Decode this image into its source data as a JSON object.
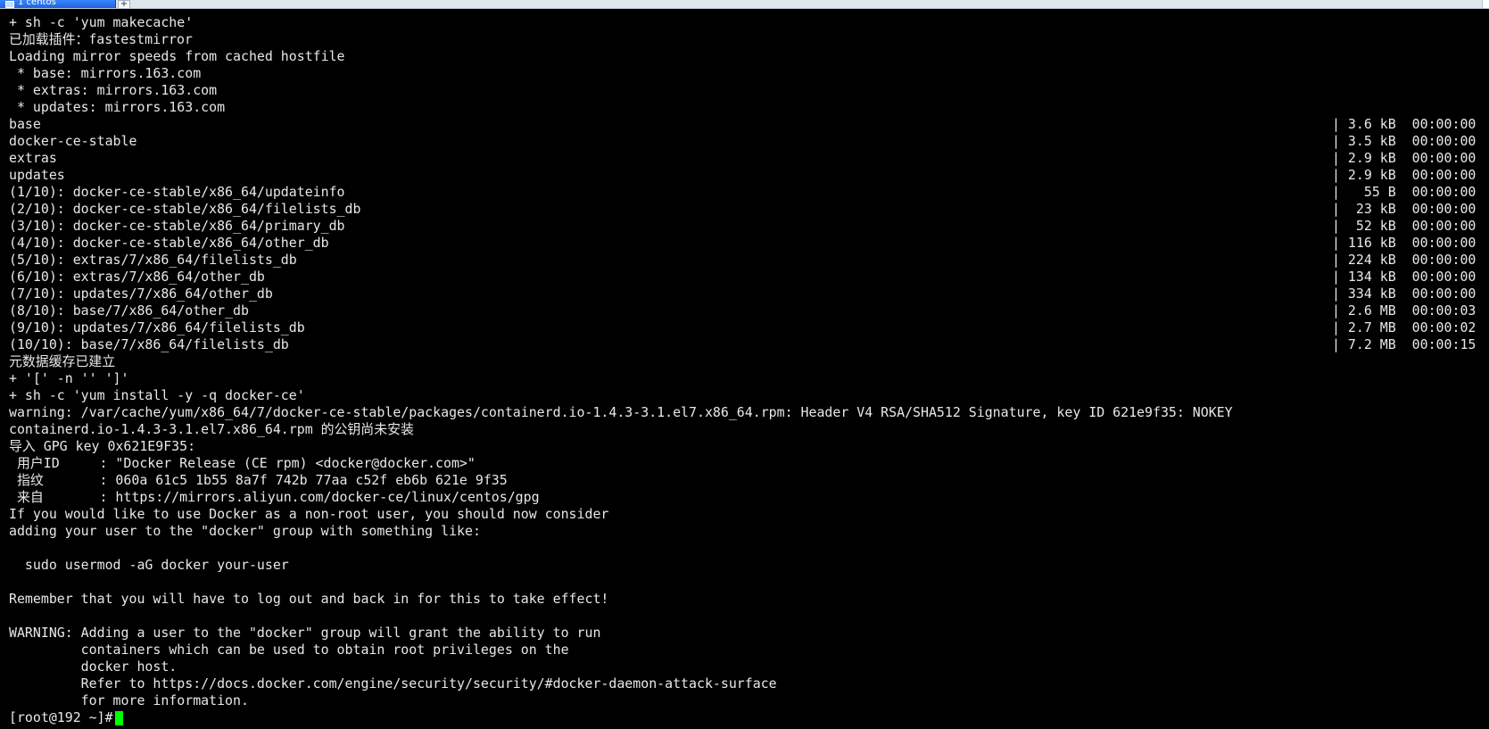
{
  "tab": {
    "title": "1 centos",
    "add_label": "+"
  },
  "terminal": {
    "lines": [
      {
        "text": "+ sh -c 'yum makecache'",
        "meta": ""
      },
      {
        "text": "已加载插件：fastestmirror",
        "meta": ""
      },
      {
        "text": "Loading mirror speeds from cached hostfile",
        "meta": ""
      },
      {
        "text": " * base: mirrors.163.com",
        "meta": ""
      },
      {
        "text": " * extras: mirrors.163.com",
        "meta": ""
      },
      {
        "text": " * updates: mirrors.163.com",
        "meta": ""
      },
      {
        "text": "base",
        "meta": "| 3.6 kB  00:00:00"
      },
      {
        "text": "docker-ce-stable",
        "meta": "| 3.5 kB  00:00:00"
      },
      {
        "text": "extras",
        "meta": "| 2.9 kB  00:00:00"
      },
      {
        "text": "updates",
        "meta": "| 2.9 kB  00:00:00"
      },
      {
        "text": "(1/10): docker-ce-stable/x86_64/updateinfo",
        "meta": "|   55 B  00:00:00"
      },
      {
        "text": "(2/10): docker-ce-stable/x86_64/filelists_db",
        "meta": "|  23 kB  00:00:00"
      },
      {
        "text": "(3/10): docker-ce-stable/x86_64/primary_db",
        "meta": "|  52 kB  00:00:00"
      },
      {
        "text": "(4/10): docker-ce-stable/x86_64/other_db",
        "meta": "| 116 kB  00:00:00"
      },
      {
        "text": "(5/10): extras/7/x86_64/filelists_db",
        "meta": "| 224 kB  00:00:00"
      },
      {
        "text": "(6/10): extras/7/x86_64/other_db",
        "meta": "| 134 kB  00:00:00"
      },
      {
        "text": "(7/10): updates/7/x86_64/other_db",
        "meta": "| 334 kB  00:00:00"
      },
      {
        "text": "(8/10): base/7/x86_64/other_db",
        "meta": "| 2.6 MB  00:00:03"
      },
      {
        "text": "(9/10): updates/7/x86_64/filelists_db",
        "meta": "| 2.7 MB  00:00:02"
      },
      {
        "text": "(10/10): base/7/x86_64/filelists_db",
        "meta": "| 7.2 MB  00:00:15"
      },
      {
        "text": "元数据缓存已建立",
        "meta": ""
      },
      {
        "text": "+ '[' -n '' ']'",
        "meta": ""
      },
      {
        "text": "+ sh -c 'yum install -y -q docker-ce'",
        "meta": ""
      },
      {
        "text": "warning: /var/cache/yum/x86_64/7/docker-ce-stable/packages/containerd.io-1.4.3-3.1.el7.x86_64.rpm: Header V4 RSA/SHA512 Signature, key ID 621e9f35: NOKEY",
        "meta": ""
      },
      {
        "text": "containerd.io-1.4.3-3.1.el7.x86_64.rpm 的公钥尚未安装",
        "meta": ""
      },
      {
        "text": "导入 GPG key 0x621E9F35:",
        "meta": ""
      },
      {
        "text": " 用户ID     : \"Docker Release (CE rpm) <docker@docker.com>\"",
        "meta": ""
      },
      {
        "text": " 指纹       : 060a 61c5 1b55 8a7f 742b 77aa c52f eb6b 621e 9f35",
        "meta": ""
      },
      {
        "text": " 来自       : https://mirrors.aliyun.com/docker-ce/linux/centos/gpg",
        "meta": ""
      },
      {
        "text": "If you would like to use Docker as a non-root user, you should now consider",
        "meta": ""
      },
      {
        "text": "adding your user to the \"docker\" group with something like:",
        "meta": ""
      },
      {
        "text": "",
        "meta": ""
      },
      {
        "text": "  sudo usermod -aG docker your-user",
        "meta": ""
      },
      {
        "text": "",
        "meta": ""
      },
      {
        "text": "Remember that you will have to log out and back in for this to take effect!",
        "meta": ""
      },
      {
        "text": "",
        "meta": ""
      },
      {
        "text": "WARNING: Adding a user to the \"docker\" group will grant the ability to run",
        "meta": ""
      },
      {
        "text": "         containers which can be used to obtain root privileges on the",
        "meta": ""
      },
      {
        "text": "         docker host.",
        "meta": ""
      },
      {
        "text": "         Refer to https://docs.docker.com/engine/security/security/#docker-daemon-attack-surface",
        "meta": ""
      },
      {
        "text": "         for more information.",
        "meta": ""
      }
    ],
    "prompt": "[root@192 ~]#"
  }
}
